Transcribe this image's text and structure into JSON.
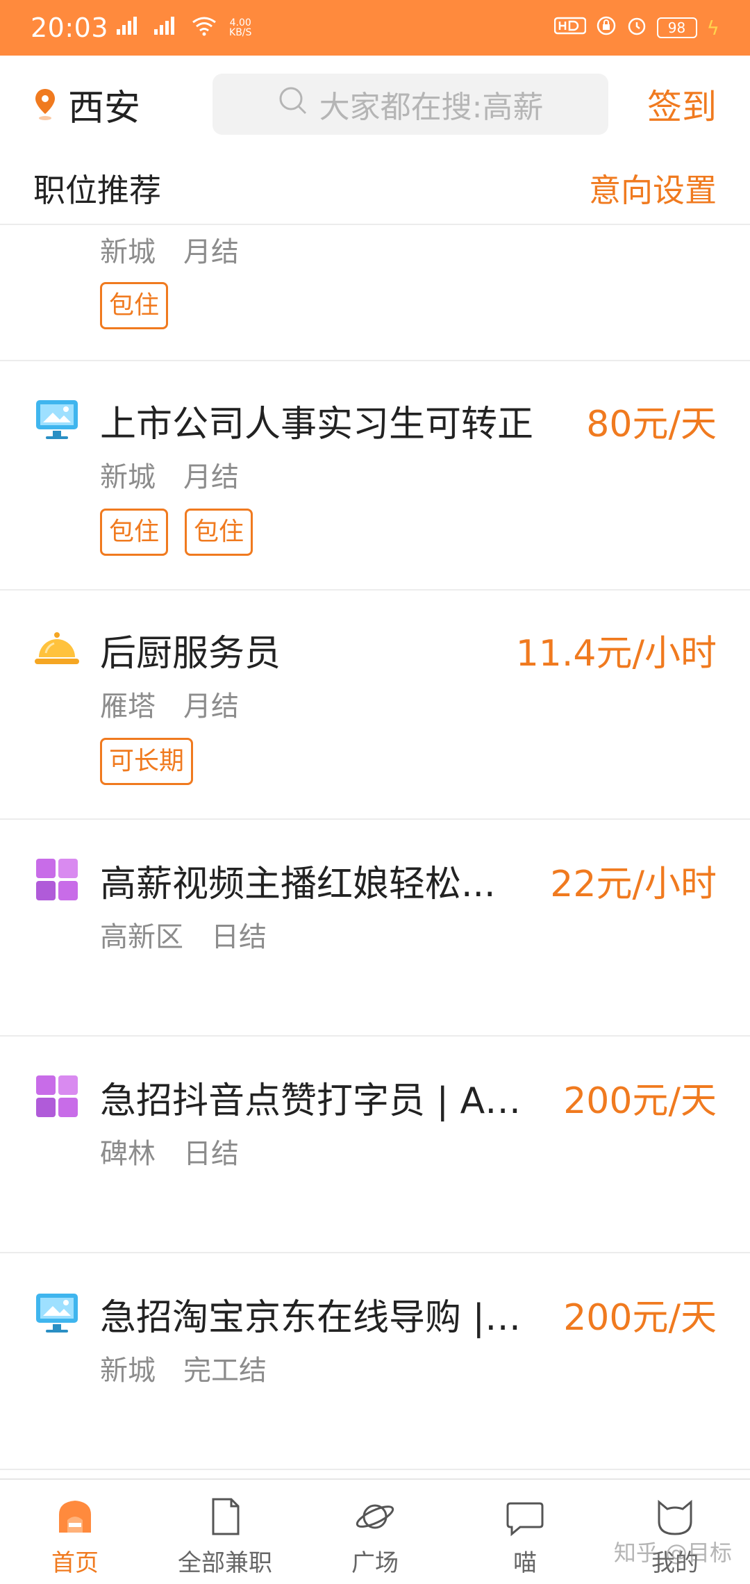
{
  "status_bar": {
    "time": "20:03",
    "network_speed_value": "4.00",
    "network_speed_unit": "KB/S",
    "battery": "98"
  },
  "header": {
    "city": "西安",
    "search_placeholder": "大家都在搜:高薪",
    "signin": "签到"
  },
  "subheader": {
    "title": "职位推荐",
    "action": "意向设置"
  },
  "jobs": [
    {
      "title": "",
      "pay": "",
      "district": "新城",
      "settlement": "月结",
      "tags": [
        "包住"
      ],
      "icon": "none"
    },
    {
      "title": "上市公司人事实习生可转正",
      "pay": "80元/天",
      "district": "新城",
      "settlement": "月结",
      "tags": [
        "包住",
        "包住"
      ],
      "icon": "monitor-icon"
    },
    {
      "title": "后厨服务员",
      "pay": "11.4元/小时",
      "district": "雁塔",
      "settlement": "月结",
      "tags": [
        "可长期"
      ],
      "icon": "cloche-icon"
    },
    {
      "title": "高薪视频主播红娘轻松...",
      "pay": "22元/小时",
      "district": "高新区",
      "settlement": "日结",
      "tags": [],
      "icon": "grid-icon"
    },
    {
      "title": "急招抖音点赞打字员 | AP...",
      "pay": "200元/天",
      "district": "碑林",
      "settlement": "日结",
      "tags": [],
      "icon": "grid-icon"
    },
    {
      "title": "急招淘宝京东在线导购 | ...",
      "pay": "200元/天",
      "district": "新城",
      "settlement": "完工结",
      "tags": [],
      "icon": "monitor-icon"
    }
  ],
  "tabbar": {
    "items": [
      {
        "label": "首页",
        "icon": "home-icon",
        "active": true
      },
      {
        "label": "全部兼职",
        "icon": "document-icon",
        "active": false
      },
      {
        "label": "广场",
        "icon": "planet-icon",
        "active": false
      },
      {
        "label": "喵",
        "icon": "chat-bubble-icon",
        "active": false
      },
      {
        "label": "我的",
        "icon": "cat-icon",
        "active": false
      }
    ]
  },
  "watermark": "知乎 @目标",
  "colors": {
    "accent": "#f07a1f",
    "status_bar": "#ff8a3d",
    "text_secondary": "#8c8c8c"
  }
}
